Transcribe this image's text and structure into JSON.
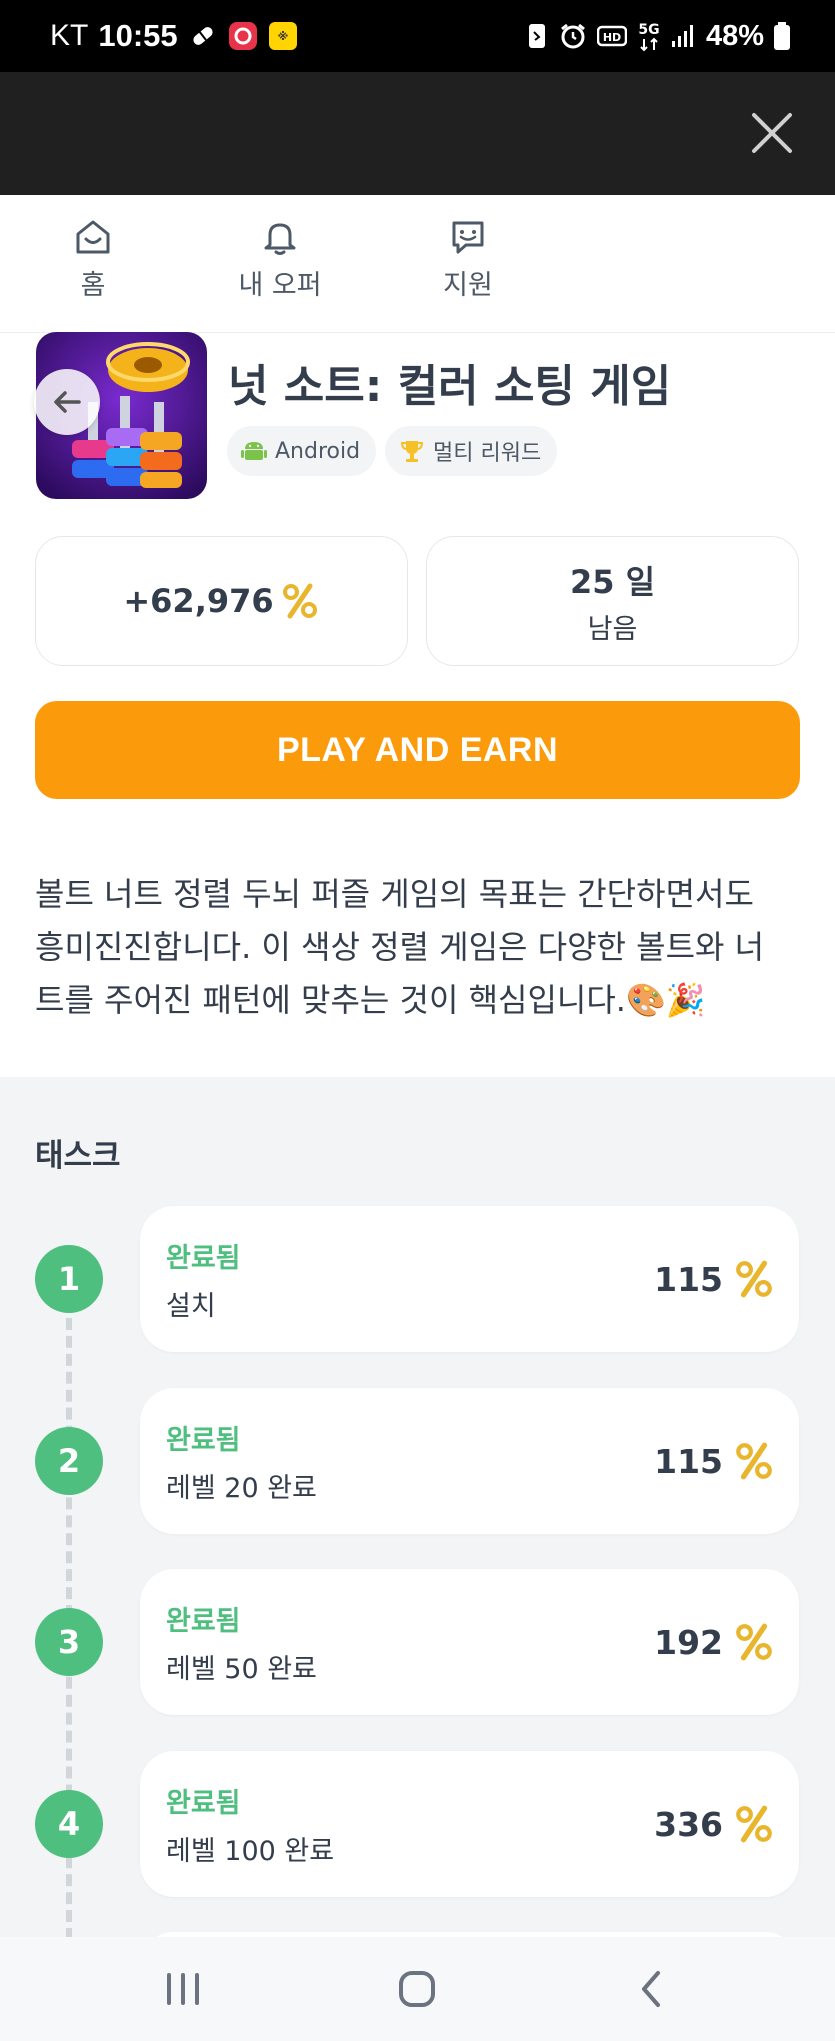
{
  "status_bar": {
    "carrier": "KT",
    "time": "10:55",
    "battery": "48%"
  },
  "tabs": [
    {
      "label": "홈",
      "icon": "home-smile-icon"
    },
    {
      "label": "내 오퍼",
      "icon": "bell-icon"
    },
    {
      "label": "지원",
      "icon": "chat-smile-icon"
    }
  ],
  "app": {
    "title": "넛 소트: 컬러 소팅 게임",
    "platform": "Android",
    "reward_type": "멀티 리워드"
  },
  "stats": {
    "points": "+62,976",
    "days": "25 일",
    "days_sub": "남음"
  },
  "cta_label": "PLAY AND EARN",
  "description": {
    "line1": "볼트 너트 정렬 두뇌 퍼즐 게임의 목표는 간단하면서도",
    "line2": "흥미진진합니다. 이 색상 정렬 게임은 다양한 볼트와 너",
    "line3": "트를 주어진 패턴에 맞추는 것이 핵심입니다.🎨🎉"
  },
  "tasks": {
    "title": "태스크",
    "items": [
      {
        "num": "1",
        "status": "완료됨",
        "name": "설치",
        "reward": "115"
      },
      {
        "num": "2",
        "status": "완료됨",
        "name": "레벨 20 완료",
        "reward": "115"
      },
      {
        "num": "3",
        "status": "완료됨",
        "name": "레벨 50 완료",
        "reward": "192"
      },
      {
        "num": "4",
        "status": "완료됨",
        "name": "레벨 100 완료",
        "reward": "336"
      }
    ]
  },
  "colors": {
    "accent_orange": "#fb9a0a",
    "complete_green": "#4fbf7f",
    "coin_gold": "#f4c430"
  }
}
